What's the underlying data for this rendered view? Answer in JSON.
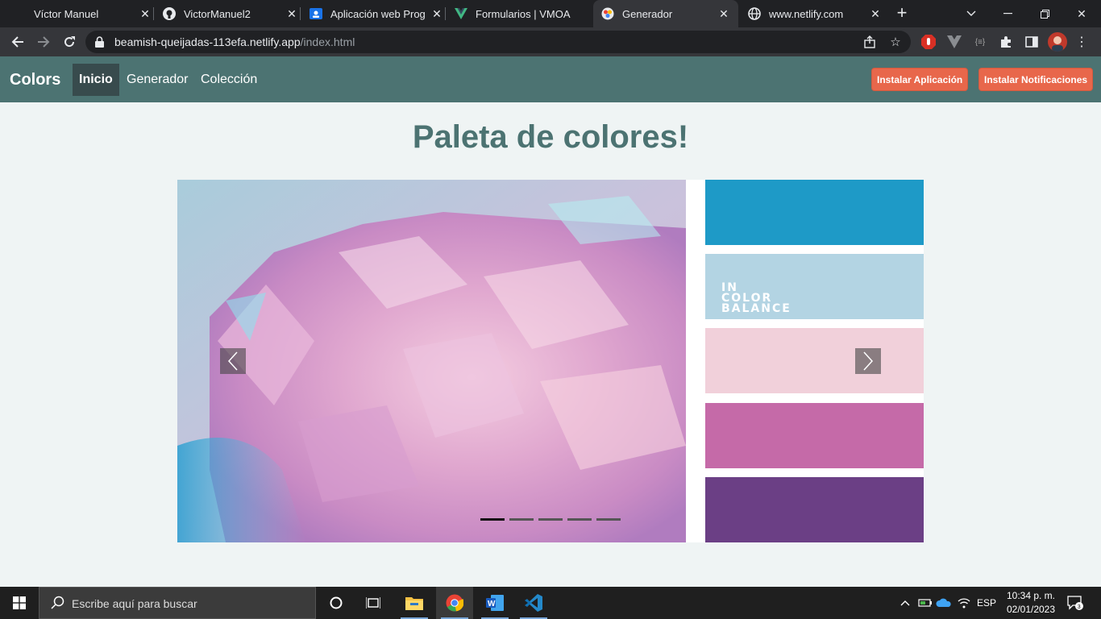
{
  "browser": {
    "tabs": [
      {
        "title": "Víctor Manuel",
        "icon": "tab-default-icon"
      },
      {
        "title": "VictorManuel2",
        "icon": "github-icon"
      },
      {
        "title": "Aplicación web Progre",
        "icon": "classroom-icon"
      },
      {
        "title": "Formularios | VMOA",
        "icon": "vue-icon"
      },
      {
        "title": "Generador",
        "icon": "color-wheel-icon",
        "active": true
      },
      {
        "title": "www.netlify.com",
        "icon": "globe-icon"
      }
    ],
    "url_host": "beamish-queijadas-113efa.netlify.app",
    "url_path": "/index.html"
  },
  "site": {
    "brand": "Colors",
    "nav": [
      "Inicio",
      "Generador",
      "Colección"
    ],
    "install_app": "Instalar Aplicación",
    "install_notifications": "Instalar Notificaciones",
    "heading": "Paleta de colores!",
    "carousel": {
      "swatch_colors": [
        "#1e9ac7",
        "#b3d4e3",
        "#f1d0da",
        "#c56aa8",
        "#6b3f85"
      ],
      "swatch_caption_lines": [
        "IN",
        "COLOR",
        "BALANCE"
      ],
      "slide_count": 5,
      "active_slide": 1
    }
  },
  "taskbar": {
    "search_placeholder": "Escribe aquí para buscar",
    "language": "ESP",
    "time": "10:34 p. m.",
    "date": "02/01/2023",
    "notification_count": "3"
  }
}
